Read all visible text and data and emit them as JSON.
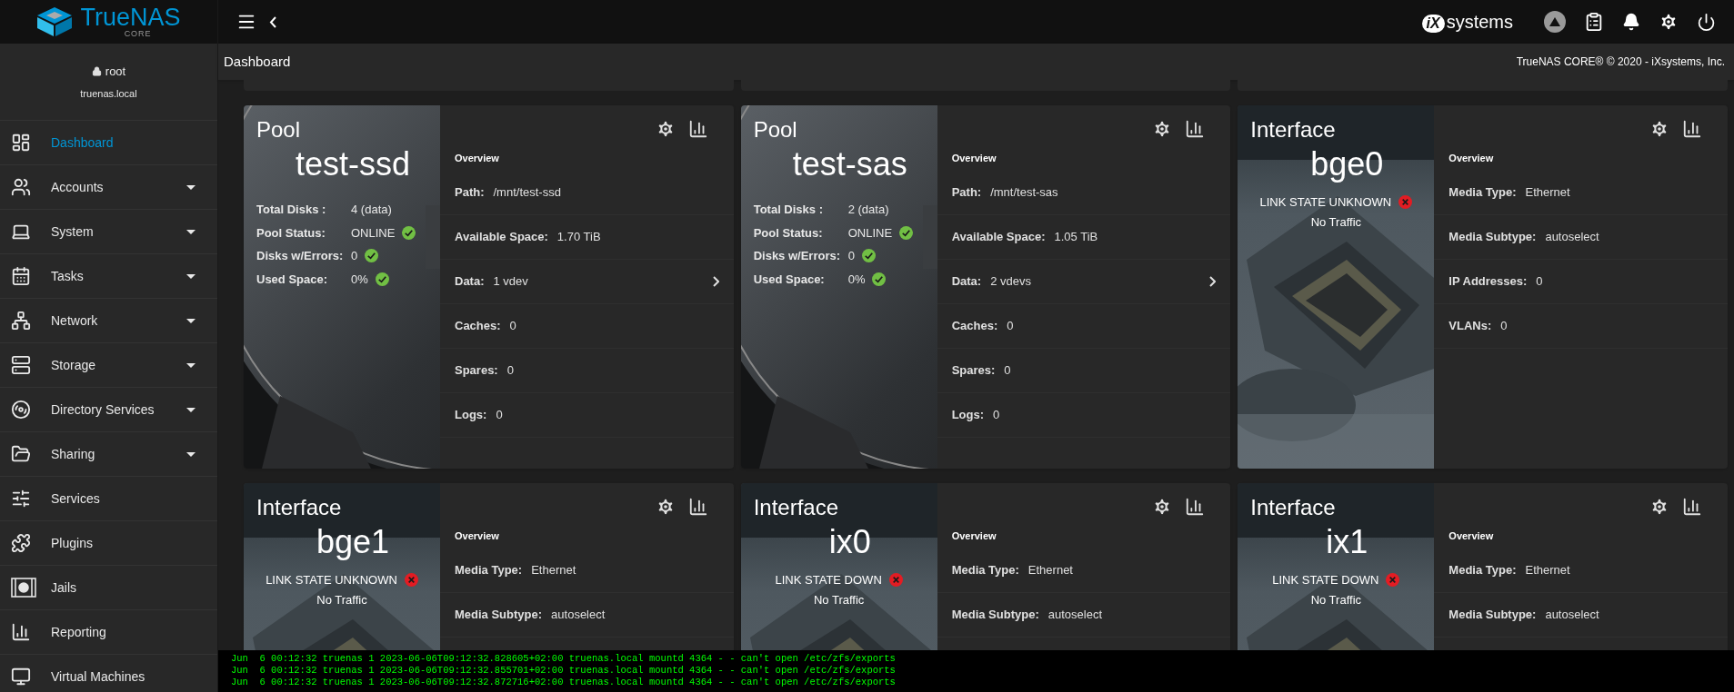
{
  "brand": {
    "name": "TrueNAS",
    "edition": "CORE"
  },
  "topbar": {
    "vendor_logo": {
      "mark": "iX",
      "word": "systems"
    }
  },
  "user": {
    "name": "root",
    "host": "truenas.local"
  },
  "sidebar": {
    "items": [
      {
        "label": "Dashboard",
        "selected": true,
        "expandable": false
      },
      {
        "label": "Accounts",
        "selected": false,
        "expandable": true
      },
      {
        "label": "System",
        "selected": false,
        "expandable": true
      },
      {
        "label": "Tasks",
        "selected": false,
        "expandable": true
      },
      {
        "label": "Network",
        "selected": false,
        "expandable": true
      },
      {
        "label": "Storage",
        "selected": false,
        "expandable": true
      },
      {
        "label": "Directory Services",
        "selected": false,
        "expandable": true
      },
      {
        "label": "Sharing",
        "selected": false,
        "expandable": true
      },
      {
        "label": "Services",
        "selected": false,
        "expandable": false
      },
      {
        "label": "Plugins",
        "selected": false,
        "expandable": false
      },
      {
        "label": "Jails",
        "selected": false,
        "expandable": false
      },
      {
        "label": "Reporting",
        "selected": false,
        "expandable": false
      },
      {
        "label": "Virtual Machines",
        "selected": false,
        "expandable": false
      }
    ]
  },
  "breadcrumb": {
    "title": "Dashboard",
    "copyright": "TrueNAS CORE® © 2020 - iXsystems, Inc."
  },
  "cards": [
    {
      "kind": "pool",
      "title": "Pool",
      "name": "test-ssd",
      "section": "Overview",
      "stats": [
        {
          "label": "Total Disks :",
          "value": "4 (data)"
        },
        {
          "label": "Pool Status:",
          "value": "ONLINE",
          "ok": true
        },
        {
          "label": "Disks w/Errors:",
          "value": "0",
          "ok": true
        },
        {
          "label": "Used Space:",
          "value": "0%",
          "ok": true
        }
      ],
      "details": [
        {
          "label": "Path:",
          "value": "/mnt/test-ssd",
          "expandable": false
        },
        {
          "label": "Available Space:",
          "value": "1.70 TiB",
          "expandable": false
        },
        {
          "label": "Data:",
          "value": "1 vdev",
          "expandable": true
        },
        {
          "label": "Caches:",
          "value": "0",
          "expandable": false
        },
        {
          "label": "Spares:",
          "value": "0",
          "expandable": false
        },
        {
          "label": "Logs:",
          "value": "0",
          "expandable": false
        }
      ]
    },
    {
      "kind": "pool",
      "title": "Pool",
      "name": "test-sas",
      "section": "Overview",
      "stats": [
        {
          "label": "Total Disks :",
          "value": "2 (data)"
        },
        {
          "label": "Pool Status:",
          "value": "ONLINE",
          "ok": true
        },
        {
          "label": "Disks w/Errors:",
          "value": "0",
          "ok": true
        },
        {
          "label": "Used Space:",
          "value": "0%",
          "ok": true
        }
      ],
      "details": [
        {
          "label": "Path:",
          "value": "/mnt/test-sas",
          "expandable": false
        },
        {
          "label": "Available Space:",
          "value": "1.05 TiB",
          "expandable": false
        },
        {
          "label": "Data:",
          "value": "2 vdevs",
          "expandable": true
        },
        {
          "label": "Caches:",
          "value": "0",
          "expandable": false
        },
        {
          "label": "Spares:",
          "value": "0",
          "expandable": false
        },
        {
          "label": "Logs:",
          "value": "0",
          "expandable": false
        }
      ]
    },
    {
      "kind": "interface",
      "title": "Interface",
      "name": "bge0",
      "link_state": "LINK STATE UNKNOWN",
      "link_ok": false,
      "traffic": "No Traffic",
      "section": "Overview",
      "details": [
        {
          "label": "Media Type:",
          "value": "Ethernet",
          "expandable": false
        },
        {
          "label": "Media Subtype:",
          "value": "autoselect",
          "expandable": false
        },
        {
          "label": "IP Addresses:",
          "value": "0",
          "expandable": false
        },
        {
          "label": "VLANs:",
          "value": "0",
          "expandable": false
        }
      ]
    },
    {
      "kind": "interface",
      "title": "Interface",
      "name": "bge1",
      "link_state": "LINK STATE UNKNOWN",
      "link_ok": false,
      "traffic": "No Traffic",
      "section": "Overview",
      "details": [
        {
          "label": "Media Type:",
          "value": "Ethernet",
          "expandable": false
        },
        {
          "label": "Media Subtype:",
          "value": "autoselect",
          "expandable": false
        }
      ]
    },
    {
      "kind": "interface",
      "title": "Interface",
      "name": "ix0",
      "link_state": "LINK STATE DOWN",
      "link_ok": false,
      "traffic": "No Traffic",
      "section": "Overview",
      "details": [
        {
          "label": "Media Type:",
          "value": "Ethernet",
          "expandable": false
        },
        {
          "label": "Media Subtype:",
          "value": "autoselect",
          "expandable": false
        }
      ]
    },
    {
      "kind": "interface",
      "title": "Interface",
      "name": "ix1",
      "link_state": "LINK STATE DOWN",
      "link_ok": false,
      "traffic": "No Traffic",
      "section": "Overview",
      "details": [
        {
          "label": "Media Type:",
          "value": "Ethernet",
          "expandable": false
        },
        {
          "label": "Media Subtype:",
          "value": "autoselect",
          "expandable": false
        }
      ]
    }
  ],
  "console": [
    "Jun  6 00:12:32 truenas 1 2023-06-06T09:12:32.828605+02:00 truenas.local mountd 4364 - - can't open /etc/zfs/exports",
    "Jun  6 00:12:32 truenas 1 2023-06-06T09:12:32.855701+02:00 truenas.local mountd 4364 - - can't open /etc/zfs/exports",
    "Jun  6 00:12:32 truenas 1 2023-06-06T09:12:32.872716+02:00 truenas.local mountd 4364 - - can't open /etc/zfs/exports"
  ]
}
